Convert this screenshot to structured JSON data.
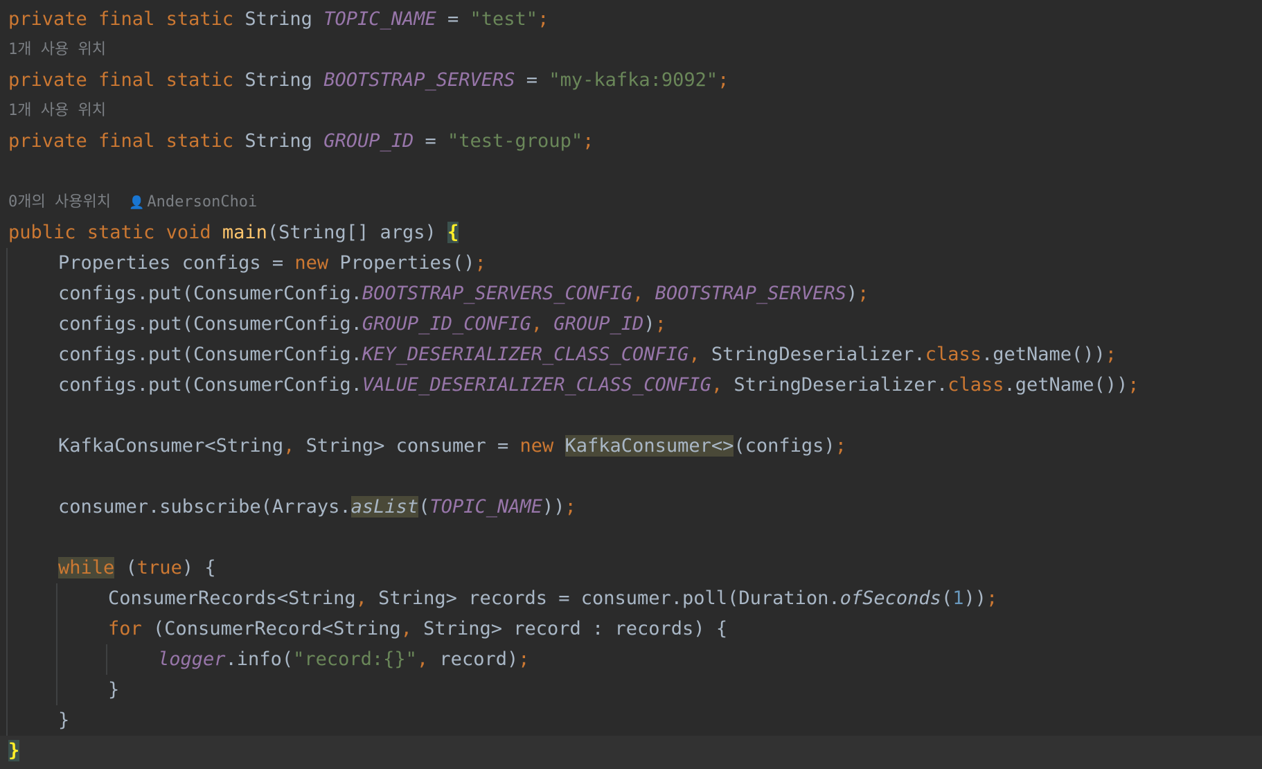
{
  "code": {
    "line1": {
      "kw": "private final static",
      "type": "String",
      "name": "TOPIC_NAME",
      "eq": " = ",
      "str": "\"test\"",
      "end": ";"
    },
    "hint1": "1개 사용 위치",
    "line2": {
      "kw": "private final static",
      "type": "String",
      "name": "BOOTSTRAP_SERVERS",
      "eq": " = ",
      "str": "\"my-kafka:9092\"",
      "end": ";"
    },
    "hint2": "1개 사용 위치",
    "line3": {
      "kw": "private final static",
      "type": "String",
      "name": "GROUP_ID",
      "eq": " = ",
      "str": "\"test-group\"",
      "end": ";"
    },
    "hint_main": {
      "usages": "0개의 사용위치",
      "author": "AndersonChoi"
    },
    "main_sig": {
      "kw": "public static void",
      "fn": "main",
      "params": "(String[] args) ",
      "brace": "{"
    },
    "l_props": {
      "a": "Properties configs = ",
      "kw": "new",
      "b": " Properties()",
      "end": ";"
    },
    "l_put1": {
      "a": "configs.put(ConsumerConfig.",
      "c1": "BOOTSTRAP_SERVERS_CONFIG",
      "sep": ", ",
      "c2": "BOOTSTRAP_SERVERS",
      "b": ")",
      "end": ";"
    },
    "l_put2": {
      "a": "configs.put(ConsumerConfig.",
      "c1": "GROUP_ID_CONFIG",
      "sep": ", ",
      "c2": "GROUP_ID",
      "b": ")",
      "end": ";"
    },
    "l_put3": {
      "a": "configs.put(ConsumerConfig.",
      "c1": "KEY_DESERIALIZER_CLASS_CONFIG",
      "sep": ", ",
      "b": "StringDeserializer.",
      "kw": "class",
      "c": ".getName())",
      "end": ";"
    },
    "l_put4": {
      "a": "configs.put(ConsumerConfig.",
      "c1": "VALUE_DESERIALIZER_CLASS_CONFIG",
      "sep": ", ",
      "b": "StringDeserializer.",
      "kw": "class",
      "c": ".getName())",
      "end": ";"
    },
    "l_consumer": {
      "a": "KafkaConsumer<String",
      "sep": ",",
      "b": " String> consumer = ",
      "kw": "new",
      "sp": " ",
      "hl": "KafkaConsumer<>",
      "c": "(configs)",
      "end": ";"
    },
    "l_subscribe": {
      "a": "consumer.subscribe(Arrays.",
      "hl": "asList",
      "b": "(",
      "c1": "TOPIC_NAME",
      "c": "))",
      "end": ";"
    },
    "l_while": {
      "kw": "while",
      "a": " (",
      "kw2": "true",
      "b": ") {"
    },
    "l_records": {
      "a": "ConsumerRecords<String",
      "sep": ",",
      "b": " String> records = consumer.poll(Duration.",
      "it": "ofSeconds",
      "c": "(",
      "num": "1",
      "d": "))",
      "end": ";"
    },
    "l_for": {
      "kw": "for",
      "a": " (ConsumerRecord<String",
      "sep": ",",
      "b": " String> record : records) {"
    },
    "l_log": {
      "c1": "logger",
      "a": ".info(",
      "str": "\"record:{}\"",
      "sep": ",",
      "b": " record)",
      "end": ";"
    },
    "close_for": "}",
    "close_while": "}",
    "close_main": "}"
  }
}
